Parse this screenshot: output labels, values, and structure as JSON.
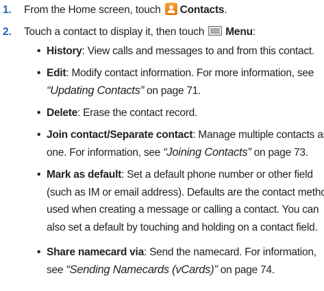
{
  "steps": [
    {
      "number": "1.",
      "before": "From the Home screen, touch",
      "icon": "contacts-app-icon",
      "label": "Contacts",
      "after": "."
    },
    {
      "number": "2.",
      "before": "Touch a contact to display it, then touch",
      "icon": "menu-icon",
      "label": "Menu",
      "after": ":"
    }
  ],
  "bullets": [
    {
      "term": "History",
      "lines": [
        {
          "text": ": View calls and messages to and from this contact."
        }
      ]
    },
    {
      "term": "Edit",
      "lines": [
        {
          "text": ": Modify contact information. For more information, see"
        },
        {
          "ref": "“Updating Contacts”",
          "text": " on page 71."
        }
      ]
    },
    {
      "term": "Delete",
      "lines": [
        {
          "text": ": Erase the contact record."
        }
      ]
    },
    {
      "term": "Join contact/Separate contact",
      "lines": [
        {
          "text": ": Manage multiple contacts as"
        },
        {
          "text": "one. For information, see ",
          "ref": "“Joining Contacts”",
          "after": " on page 73."
        }
      ]
    },
    {
      "term": "Mark as default",
      "lines": [
        {
          "text": ": Set a default phone number or other field"
        },
        {
          "text": "(such as IM or email address). Defaults are the contact method"
        },
        {
          "text": "used when creating a message or calling a contact. You can"
        },
        {
          "text": "also set a default by touching and holding on a contact field."
        }
      ]
    },
    {
      "term": "Share namecard via",
      "lines": [
        {
          "text": ": Send the namecard. For information,"
        },
        {
          "text": "see ",
          "ref": "“Sending Namecards (vCards)”",
          "after": " on page 74."
        }
      ]
    }
  ],
  "colors": {
    "step_number": "#1f63b5",
    "contacts_icon": "#f0901f",
    "menu_icon": "#6b6b6b"
  }
}
